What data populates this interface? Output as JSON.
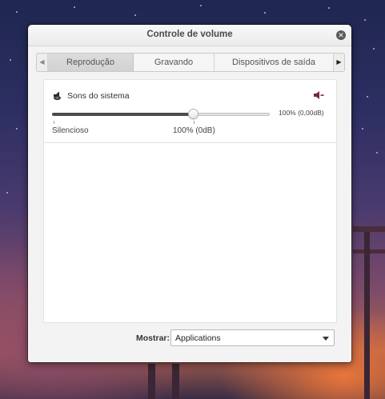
{
  "window": {
    "title": "Controle de volume"
  },
  "tabs": [
    {
      "label": "Reprodução",
      "active": true
    },
    {
      "label": "Gravando",
      "active": false
    },
    {
      "label": "Dispositivos de saída",
      "active": false
    }
  ],
  "stream": {
    "name": "Sons do sistema",
    "icon": "speaker-icon",
    "volume_text": "100% (0,00dB)",
    "volume_fraction": 0.65,
    "marks": {
      "min_label": "Silencioso",
      "unity_label": "100% (0dB)"
    }
  },
  "footer": {
    "show_label": "Mostrar:",
    "show_value": "Applications"
  },
  "colors": {
    "slider_fill": "#4b4b4b",
    "mute_icon": "#7a2a36"
  }
}
